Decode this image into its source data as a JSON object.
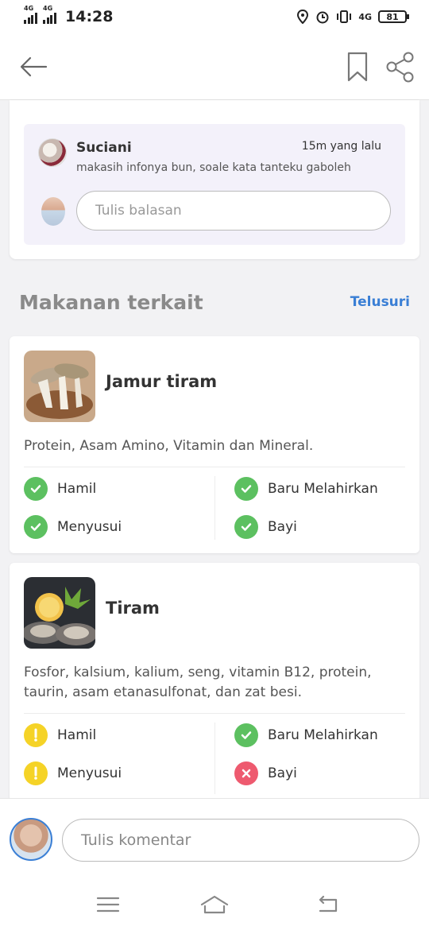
{
  "status_bar": {
    "net1": "4G",
    "net2": "4G",
    "time": "14:28",
    "net3": "4G",
    "battery": "81"
  },
  "topbar": {
    "back_icon": "arrow-left-icon",
    "bookmark_icon": "bookmark-icon",
    "share_icon": "share-icon"
  },
  "comment": {
    "author": "Suciani",
    "time": "15m yang lalu",
    "text": "makasih infonya bun, soale kata tanteku gaboleh",
    "reply_placeholder": "Tulis balasan"
  },
  "related": {
    "title": "Makanan terkait",
    "link": "Telusuri",
    "foods": [
      {
        "name": "Jamur tiram",
        "description": "Protein, Asam Amino, Vitamin dan Mineral.",
        "statuses": [
          {
            "label": "Hamil",
            "state": "ok"
          },
          {
            "label": "Baru Melahirkan",
            "state": "ok"
          },
          {
            "label": "Menyusui",
            "state": "ok"
          },
          {
            "label": "Bayi",
            "state": "ok"
          }
        ]
      },
      {
        "name": "Tiram",
        "description": "Fosfor, kalsium, kalium, seng, vitamin B12, protein, taurin, asam etanasulfonat, dan zat besi.",
        "statuses": [
          {
            "label": "Hamil",
            "state": "warn"
          },
          {
            "label": "Baru Melahirkan",
            "state": "ok"
          },
          {
            "label": "Menyusui",
            "state": "warn"
          },
          {
            "label": "Bayi",
            "state": "no"
          }
        ]
      }
    ]
  },
  "bottom": {
    "comment_placeholder": "Tulis komentar"
  },
  "colors": {
    "ok": "#5cc060",
    "warn": "#f5d327",
    "no": "#ee5a6f",
    "link": "#3a7fd5"
  }
}
